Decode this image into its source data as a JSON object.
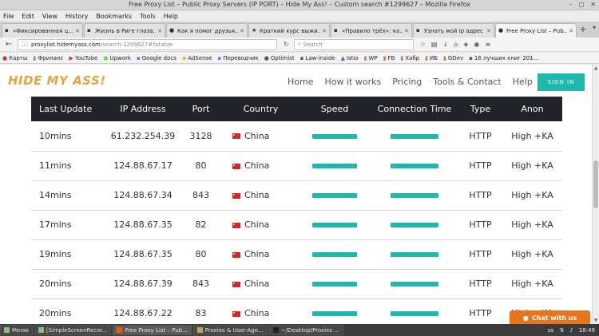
{
  "window": {
    "title": "Free Proxy List – Public Proxy Servers (IP PORT) – Hide My Ass! – Custom search #1299627 – Mozilla Firefox",
    "controls": [
      "–",
      "◻",
      "✕"
    ]
  },
  "menu": [
    "File",
    "Edit",
    "View",
    "History",
    "Bookmarks",
    "Tools",
    "Help"
  ],
  "tabs": [
    {
      "label": "«Фиксированная ц...",
      "active": false
    },
    {
      "label": "Жизнь в Риге глаза...",
      "active": false
    },
    {
      "label": "Как я помог друзья...",
      "active": false
    },
    {
      "label": "Краткий курс выжи...",
      "active": false
    },
    {
      "label": "«Правило трёх»: ка...",
      "active": false
    },
    {
      "label": "Узнать мой ip адрес",
      "active": false
    },
    {
      "label": "Free Proxy List – Pub...",
      "active": true
    }
  ],
  "nav": {
    "url_host": "proxylist.hidemyass.com",
    "url_path": "/search-1299627#listable",
    "search_placeholder": "Search"
  },
  "bookmarks": [
    "Карты",
    "Фриланс",
    "YouTube",
    "Upwork",
    "Google docs",
    "AdSense",
    "Переводчик",
    "Optimist",
    "Law-inside",
    "Istio",
    "WP",
    "FB",
    "Хабр",
    "ИБ",
    "GDev",
    "16 лучших книг 201..."
  ],
  "site": {
    "logo": "HIDE MY ASS!",
    "nav": [
      "Home",
      "How it works",
      "Pricing",
      "Tools & Contact",
      "Help"
    ],
    "signin": "SIGN IN"
  },
  "table": {
    "headers": [
      "Last Update",
      "IP Address",
      "Port",
      "Country",
      "Speed",
      "Connection Time",
      "Type",
      "Anon"
    ],
    "rows": [
      {
        "last_update": "10mins",
        "ip": "61.232.254.39",
        "port": "3128",
        "country": "China",
        "speed": 1.0,
        "connection": 1.0,
        "type": "HTTP",
        "anon": "High +KA"
      },
      {
        "last_update": "11mins",
        "ip": "124.88.67.17",
        "port": "80",
        "country": "China",
        "speed": 1.0,
        "connection": 1.0,
        "type": "HTTP",
        "anon": "High +KA"
      },
      {
        "last_update": "14mins",
        "ip": "124.88.67.34",
        "port": "843",
        "country": "China",
        "speed": 1.0,
        "connection": 1.0,
        "type": "HTTP",
        "anon": "High +KA"
      },
      {
        "last_update": "17mins",
        "ip": "124.88.67.35",
        "port": "82",
        "country": "China",
        "speed": 1.0,
        "connection": 1.0,
        "type": "HTTP",
        "anon": "High +KA"
      },
      {
        "last_update": "19mins",
        "ip": "124.88.67.35",
        "port": "80",
        "country": "China",
        "speed": 1.0,
        "connection": 1.0,
        "type": "HTTP",
        "anon": "High +KA"
      },
      {
        "last_update": "20mins",
        "ip": "124.88.67.39",
        "port": "843",
        "country": "China",
        "speed": 1.0,
        "connection": 1.0,
        "type": "HTTP",
        "anon": "High +KA"
      },
      {
        "last_update": "20mins",
        "ip": "124.88.67.22",
        "port": "83",
        "country": "China",
        "speed": 1.0,
        "connection": 1.0,
        "type": "HTTP",
        "anon": "High +KA"
      }
    ]
  },
  "chat": {
    "label": "Chat with us"
  },
  "taskbar": {
    "menu": "Меню",
    "items": [
      {
        "label": "[SimpleScreenRecor...",
        "active": false
      },
      {
        "label": "Free Proxy List – Pub...",
        "active": true
      },
      {
        "label": "Proxies & User-Age...",
        "active": false
      },
      {
        "label": "~/Desktop/Proxies ...",
        "active": false
      }
    ],
    "lang": "us",
    "clock": "18:49"
  },
  "colors": {
    "accent": "#1fb8ad",
    "logo": "#e8a23a",
    "table_head": "#22242a",
    "chat": "#e8741e"
  }
}
